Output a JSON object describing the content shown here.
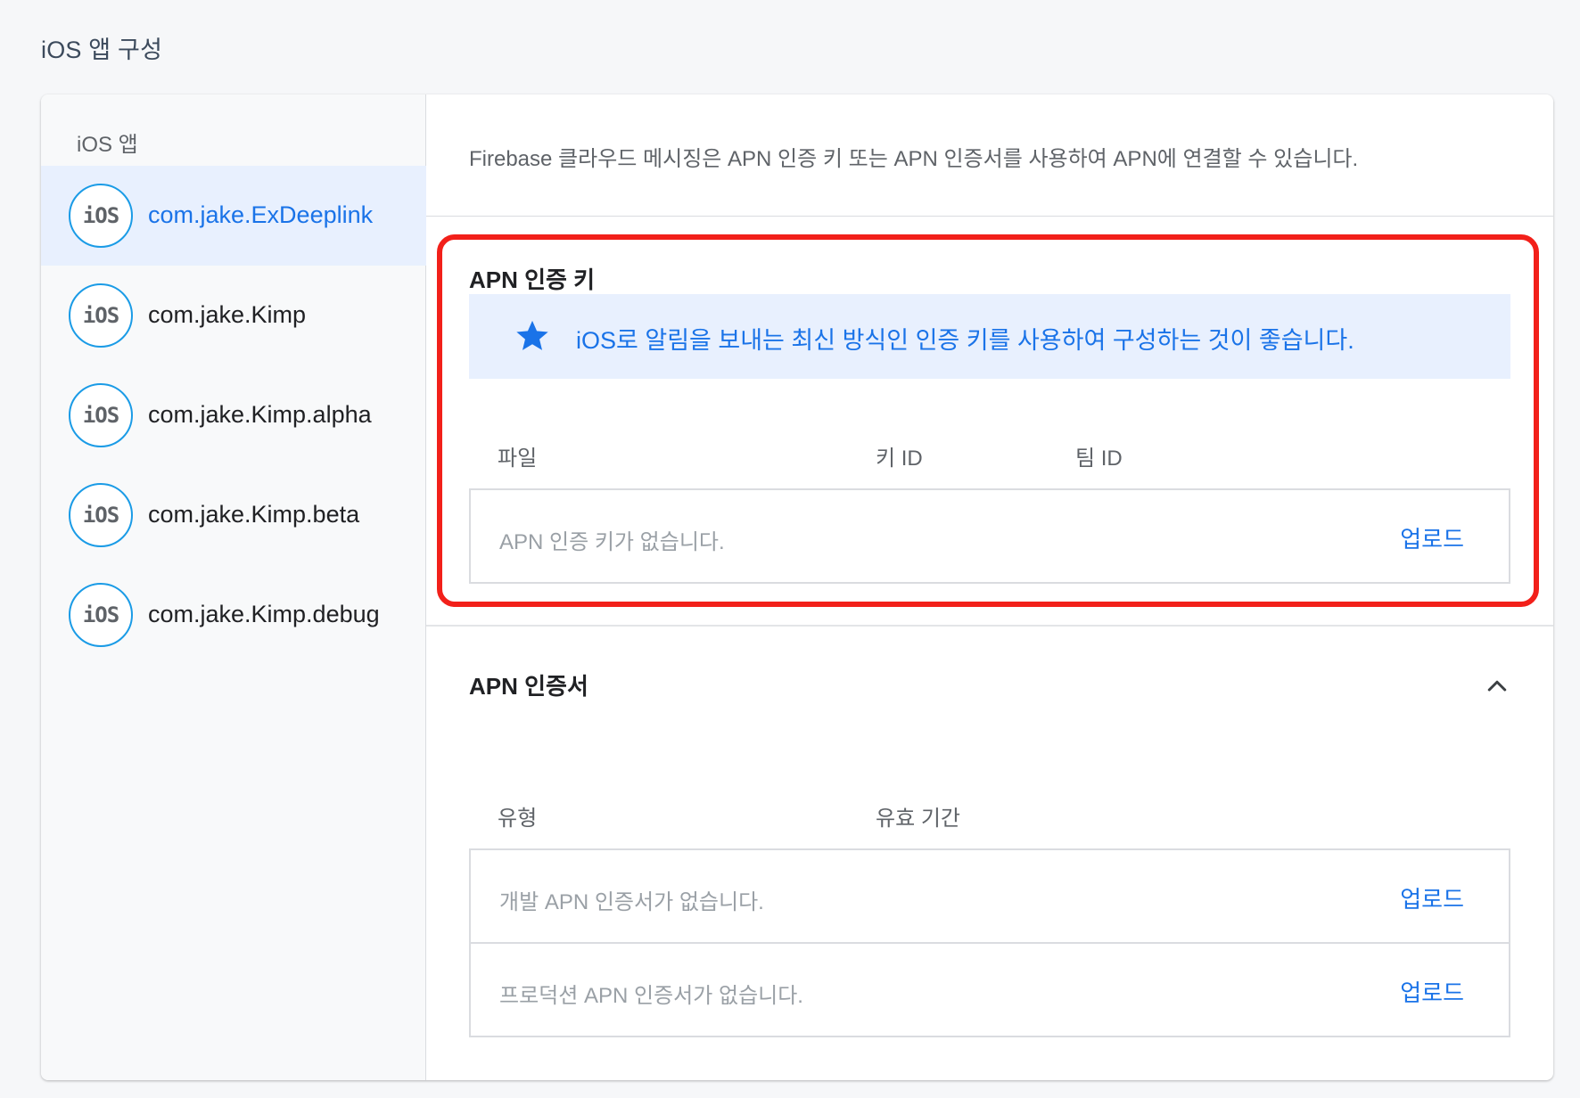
{
  "page": {
    "title": "iOS 앱 구성"
  },
  "sidebar": {
    "heading": "iOS 앱",
    "apps": [
      {
        "badge": "iOS",
        "name": "com.jake.ExDeeplink",
        "selected": true
      },
      {
        "badge": "iOS",
        "name": "com.jake.Kimp"
      },
      {
        "badge": "iOS",
        "name": "com.jake.Kimp.alpha"
      },
      {
        "badge": "iOS",
        "name": "com.jake.Kimp.beta"
      },
      {
        "badge": "iOS",
        "name": "com.jake.Kimp.debug"
      }
    ]
  },
  "intro": {
    "text": "Firebase 클라우드 메시징은 APN 인증 키 또는 APN 인증서를 사용하여 APN에 연결할 수 있습니다."
  },
  "auth_key": {
    "title": "APN 인증 키",
    "tip": {
      "icon": "star-icon",
      "text": "iOS로 알림을 보내는 최신 방식인 인증 키를 사용하여 구성하는 것이 좋습니다."
    },
    "columns": [
      "파일",
      "키 ID",
      "팀 ID"
    ],
    "row": {
      "empty_text": "APN 인증 키가 없습니다.",
      "action": "업로드"
    }
  },
  "certificates": {
    "title": "APN 인증서",
    "collapse_icon": "chevron-up-icon",
    "columns": [
      "유형",
      "유효 기간"
    ],
    "rows": [
      {
        "empty_text": "개발 APN 인증서가 없습니다.",
        "action": "업로드"
      },
      {
        "empty_text": "프로덕션 APN 인증서가 없습니다.",
        "action": "업로드"
      }
    ]
  },
  "colors": {
    "accent": "#1a73e8",
    "selected_bg": "#e8f0fe",
    "highlight_border": "#f2201a",
    "badge_ring": "#1a9be6"
  }
}
